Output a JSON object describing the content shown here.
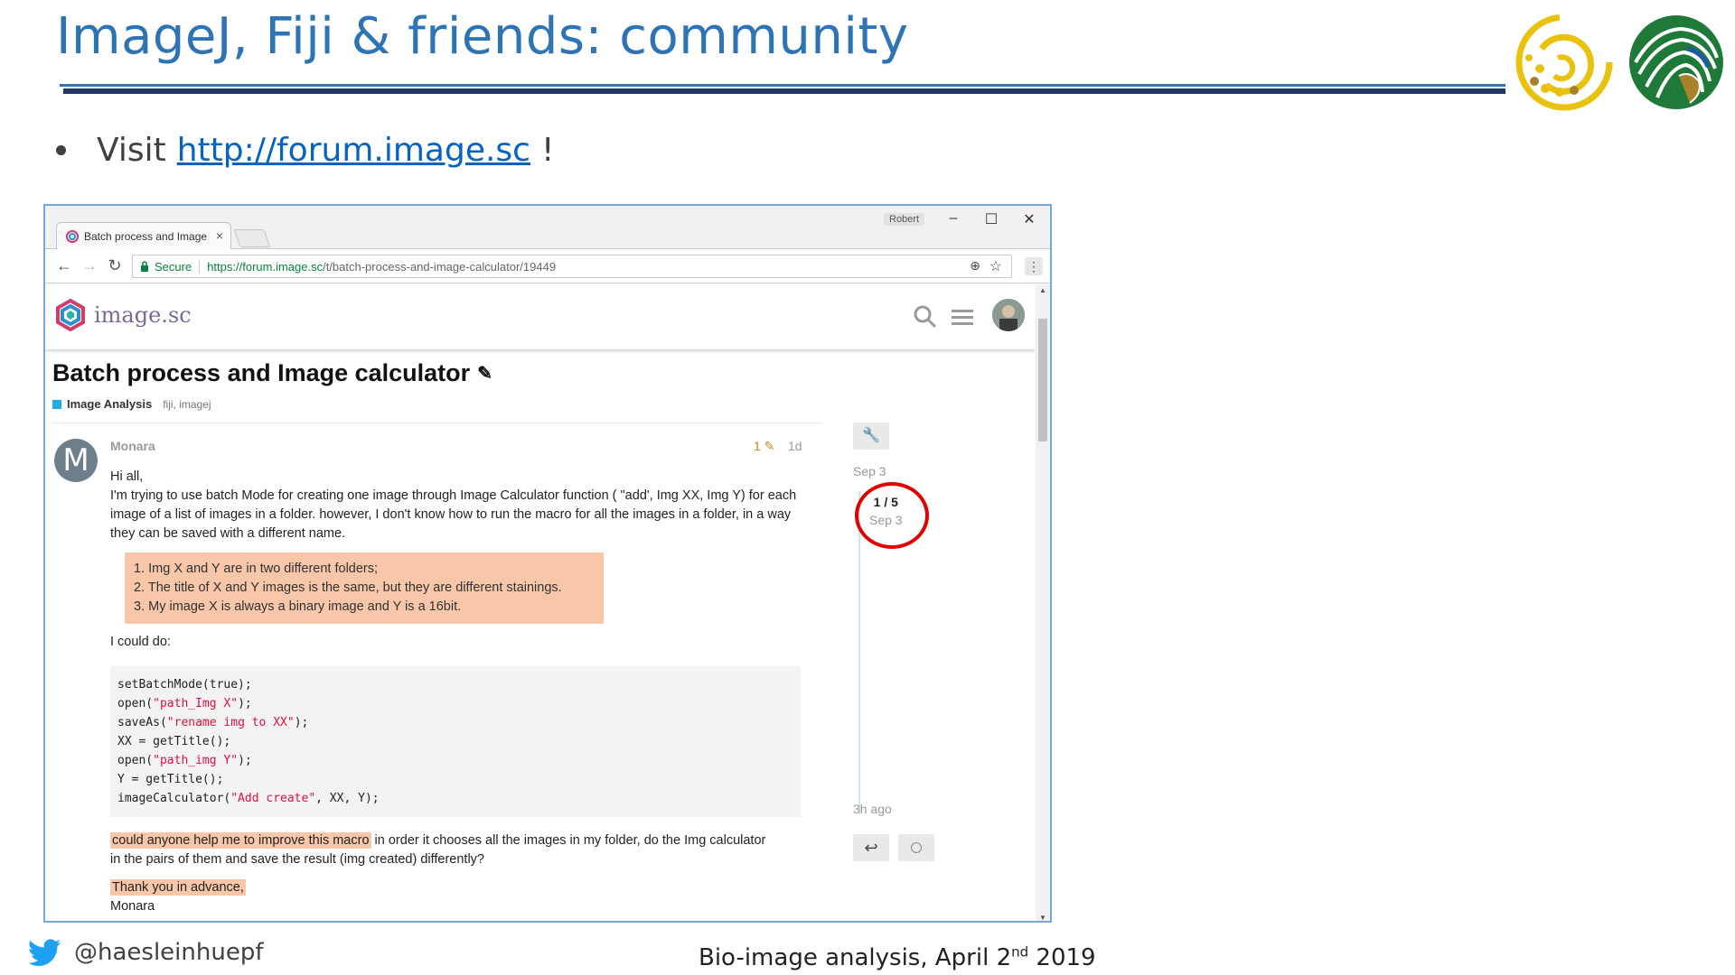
{
  "slide": {
    "title": "ImageJ, Fiji & friends: community",
    "bullet_prefix": "Visit",
    "bullet_link": "http://forum.image.sc",
    "bullet_suffix": "!",
    "footer_handle": "@haesleinhuepf",
    "footer_date_prefix": "Bio-image analysis, April 2",
    "footer_date_sup": "nd",
    "footer_date_suffix": " 2019",
    "colors": {
      "title": "#2e74b5",
      "rule": "#1f3864",
      "link": "#0563c1",
      "twitter": "#1da1f2"
    }
  },
  "browser": {
    "tab_title": "Batch process and Image",
    "tab_close": "×",
    "profile": "Robert",
    "window_controls": [
      "–",
      "☐",
      "✕"
    ],
    "secure_label": "Secure",
    "url_host": "https://forum.image.sc",
    "url_path": "/t/batch-process-and-image-calculator/19449",
    "menu_glyph": "⋮"
  },
  "forum": {
    "brand": "image.sc",
    "topic_title": "Batch process and Image calculator",
    "category": "Image Analysis",
    "tags": "fiji, imagej",
    "post": {
      "avatar_letter": "M",
      "username": "Monara",
      "edits": "1",
      "age": "1d",
      "greeting": "Hi all,",
      "intro": "I'm trying to use batch Mode for creating one image through Image Calculator function ( \"add', Img XX, Img Y) for each image of a list of images in a folder. however, I don't know how to run the macro for all the images in a folder, in a way they can be saved with a different name.",
      "list": [
        "1.  Img X and Y are in two different folders;",
        "2.  The title of X and Y images is the same, but they are different stainings.",
        "3.  My image X is always a binary image and Y is a 16bit."
      ],
      "could_do": "I could do:",
      "code": [
        {
          "pre": "setBatchMode(true);",
          "str": "",
          "post": ""
        },
        {
          "pre": "open(",
          "str": "\"path_Img X\"",
          "post": ");"
        },
        {
          "pre": "saveAs(",
          "str": "\"rename img to XX\"",
          "post": ");"
        },
        {
          "pre": "XX = getTitle();",
          "str": "",
          "post": ""
        },
        {
          "pre": "open(",
          "str": "\"path_img Y\"",
          "post": ");"
        },
        {
          "pre": "Y = getTitle();",
          "str": "",
          "post": ""
        },
        {
          "pre": "imageCalculator(",
          "str": "\"Add create\"",
          "post": ", XX, Y);"
        }
      ],
      "question_highlight": "could anyone help me to improve this macro",
      "question_rest": " in order it chooses all the images in my folder, do the Img calculator in the pairs of them and save the result (img created) differently?",
      "thanks": "Thank you in advance,",
      "signature": "Monara"
    },
    "timeline": {
      "start": "Sep 3",
      "position": "1 / 5",
      "position_date": "Sep 3",
      "end": "3h ago"
    }
  }
}
